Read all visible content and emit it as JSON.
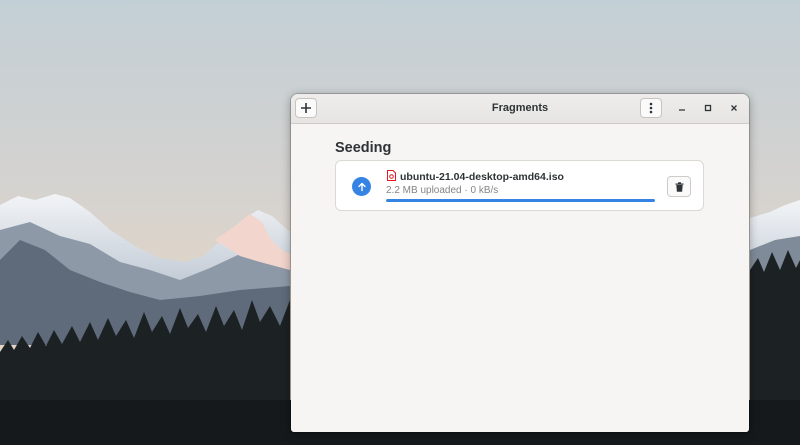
{
  "window": {
    "title": "Fragments"
  },
  "section": {
    "title": "Seeding"
  },
  "torrent": {
    "name": "ubuntu-21.04-desktop-amd64.iso",
    "info": "2.2 MB uploaded · 0 kB/s",
    "progress": 1.0,
    "status_icon": "upload-arrow-icon"
  },
  "colors": {
    "accent": "#3584e4",
    "window_bg": "#f6f5f4",
    "file_icon": "#e01b24"
  }
}
